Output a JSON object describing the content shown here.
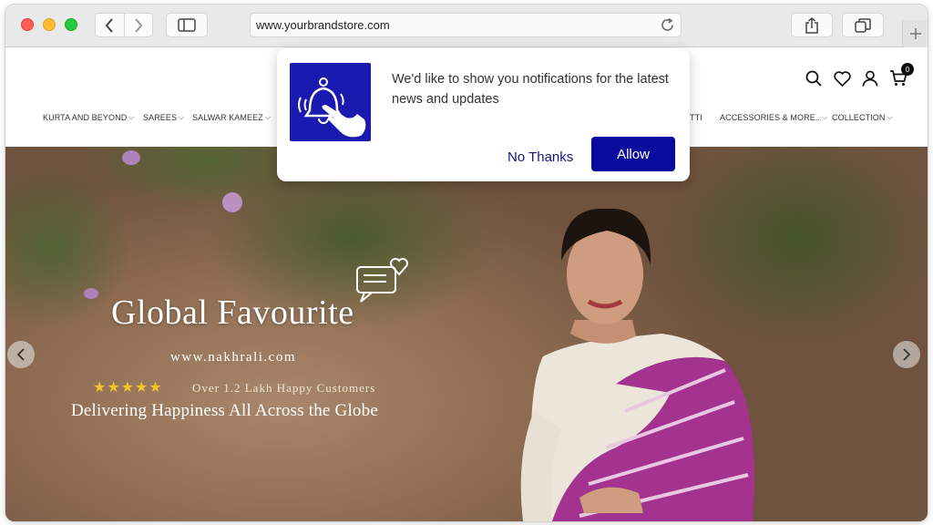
{
  "browser": {
    "url": "www.yourbrandstore.com"
  },
  "nav": {
    "items": [
      {
        "label": "KURTA AND BEYOND"
      },
      {
        "label": "SAREES"
      },
      {
        "label": "SALWAR KAMEEZ"
      },
      {
        "label": "TTI"
      },
      {
        "label": "ACCESSORIES & MORE.."
      },
      {
        "label": "COLLECTION"
      }
    ]
  },
  "header": {
    "cart_count": "0"
  },
  "notification": {
    "message": "We'd like to show you notifications for the latest news and updates",
    "no_thanks_label": "No Thanks",
    "allow_label": "Allow"
  },
  "hero": {
    "title": "Global Favourite",
    "url": "www.nakhrali.com",
    "stars": "★★★★★",
    "customers": "Over 1.2 Lakh Happy Customers",
    "tagline": "Delivering Happiness All Across the Globe"
  },
  "colors": {
    "accent": "#0a0a9e",
    "star": "#f2c230"
  }
}
